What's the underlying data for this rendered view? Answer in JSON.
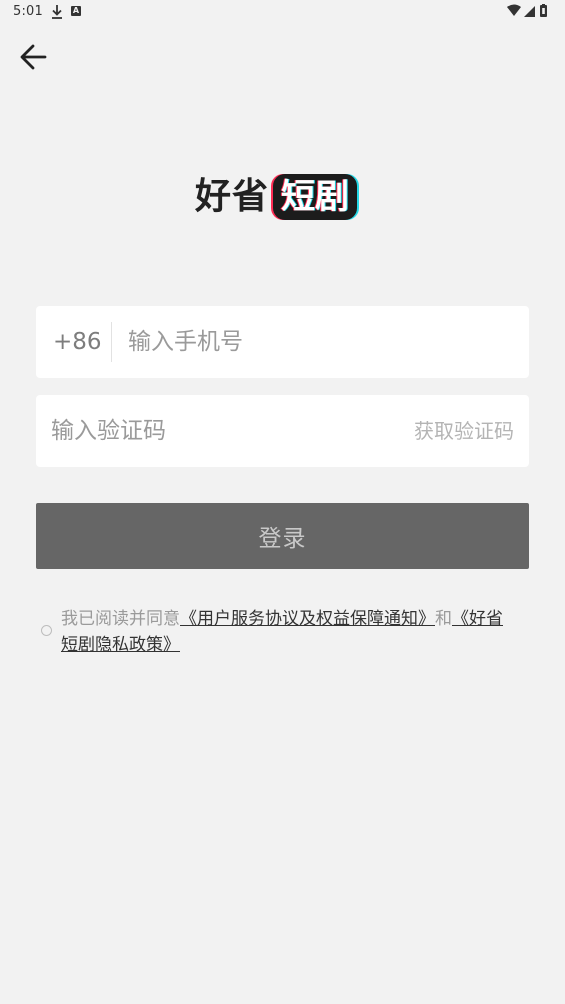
{
  "status_bar": {
    "time": "5:01",
    "icons": [
      "download-icon",
      "a-icon",
      "wifi-icon",
      "signal-icon",
      "battery-icon"
    ]
  },
  "back_icon": "arrow-left-icon",
  "logo": {
    "text_plain": "好省",
    "text_badge": "短剧"
  },
  "phone": {
    "country_code": "+86",
    "placeholder": "输入手机号",
    "value": ""
  },
  "code": {
    "placeholder": "输入验证码",
    "value": "",
    "get_code_label": "获取验证码"
  },
  "login": {
    "label": "登录"
  },
  "agreement": {
    "checked": false,
    "prefix": "我已阅读并同意",
    "link1": "《用户服务协议及权益保障通知》",
    "middle": "和",
    "link2": "《好省短剧隐私政策》"
  },
  "colors": {
    "background": "#f2f2f2",
    "card": "#ffffff",
    "button": "#666666",
    "badge": "#1c1c1c",
    "badge_accent_red": "#ff2d55",
    "badge_accent_cyan": "#25d8e6"
  }
}
